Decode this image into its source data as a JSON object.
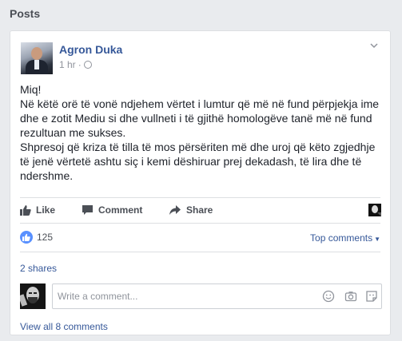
{
  "section": {
    "title": "Posts"
  },
  "post": {
    "author": "Agron Duka",
    "time": "1 hr",
    "separator": "·",
    "paragraphs": [
      "Miq!",
      "Në këtë orë të vonë ndjehem vërtet i lumtur që më në fund përpjekja ime dhe e zotit Mediu si dhe vullneti i të gjithë homologëve tanë më në fund rezultuan me sukses.",
      "Shpresoj që kriza të tilla të mos përsëriten më dhe uroj që këto zgjedhje të jenë vërtetë ashtu siç i kemi dëshiruar prej dekadash, të lira dhe të ndershme."
    ]
  },
  "actions": {
    "like": "Like",
    "comment": "Comment",
    "share": "Share"
  },
  "reactions": {
    "count": "125",
    "top_comments": "Top comments",
    "shares": "2 shares"
  },
  "comment_input": {
    "placeholder": "Write a comment..."
  },
  "footer": {
    "view_all": "View all 8 comments"
  },
  "colors": {
    "link": "#365899",
    "like_blue": "#5890ff",
    "muted": "#90949c"
  },
  "icons": [
    "chevron-down-icon",
    "globe-icon",
    "like-icon",
    "comment-icon",
    "share-icon",
    "emoji-icon",
    "camera-icon",
    "sticker-icon"
  ]
}
